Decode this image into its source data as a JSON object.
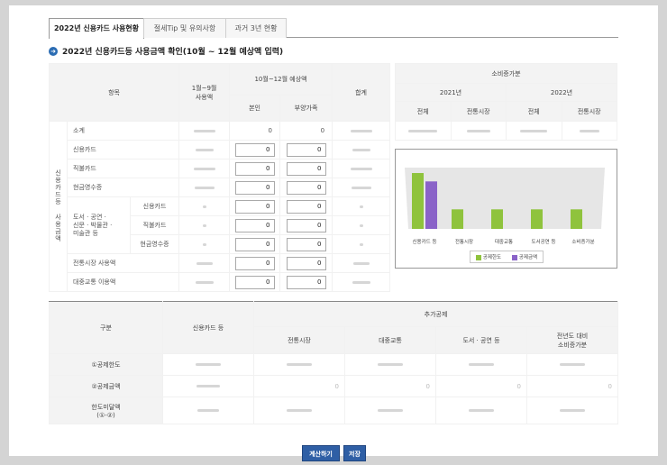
{
  "tabs": [
    "2022년 신용카드 사용현황",
    "절세Tip 및 유의사항",
    "과거 3년 현황"
  ],
  "section_title": "2022년 신용카드등 사용금액 확인(10월 ~ 12월 예상액 입력)",
  "usage_table": {
    "header_item": "항목",
    "header_jan_sep": "1월~9월\n사용액",
    "header_oct_dec": "10월~12월 예상액",
    "header_self": "본인",
    "header_dependent": "부양가족",
    "header_total": "합계",
    "group_label": "신용카드등 사용금액",
    "subtotal": "소계",
    "rows": [
      "신용카드",
      "직불카드",
      "현금영수증"
    ],
    "culture_label": "도서 · 공연 ·\n신문 · 박물관 ·\n미술관 등",
    "culture_rows": [
      "신용카드",
      "직불카드",
      "현금영수증"
    ],
    "market": "전통시장 사용액",
    "transit": "대중교통 이용액",
    "subtotal_self": "0",
    "subtotal_dependent": "0",
    "input_value": "0"
  },
  "consumption_table": {
    "title": "소비증가분",
    "year1": "2021년",
    "year2": "2022년",
    "col_all": "전체",
    "col_market": "전통시장"
  },
  "chart_data": {
    "type": "bar",
    "categories": [
      "신용카드 등",
      "전통시장",
      "대중교통",
      "도서공연 등",
      "소비증가분"
    ],
    "series": [
      {
        "name": "공제한도",
        "values": [
          100,
          35,
          35,
          35,
          35
        ]
      },
      {
        "name": "공제금액",
        "values": [
          85,
          0,
          0,
          0,
          0
        ]
      }
    ],
    "legend": [
      "공제한도",
      "공제금액"
    ],
    "legend_position": "bottom-center",
    "colors": [
      "#8fc33d",
      "#8a63c8"
    ]
  },
  "deduction_table": {
    "header_category": "구분",
    "header_card": "신용카드 등",
    "header_additional": "추가공제",
    "header_market": "전통시장",
    "header_transit": "대중교통",
    "header_culture": "도서 · 공연 등",
    "header_prev": "전년도 대비\n소비증가분",
    "rows": [
      "①공제한도",
      "②공제금액",
      "한도미달액\n(①-②)"
    ],
    "zero": "0"
  },
  "buttons": {
    "calculate": "계산하기",
    "save": "저장"
  },
  "colors": {
    "accent": "#2f5fa5",
    "bar_limit": "#8fc33d",
    "bar_amount": "#8a63c8"
  }
}
